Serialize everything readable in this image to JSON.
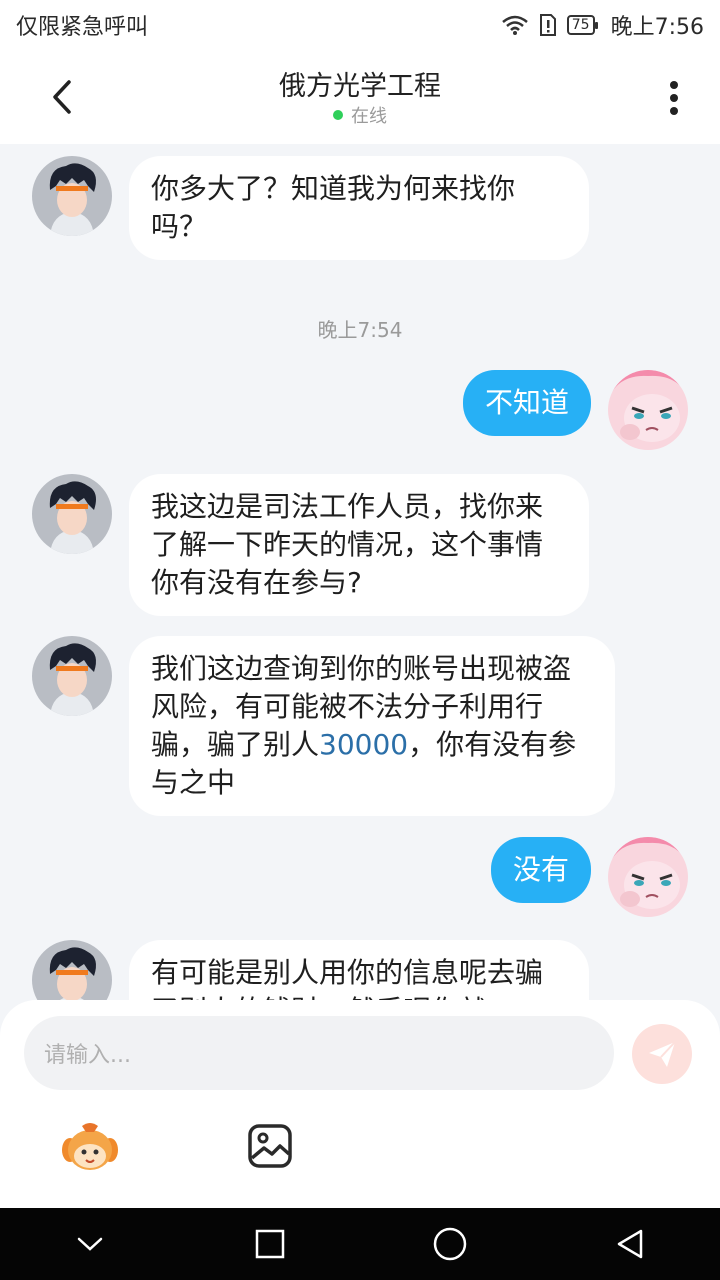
{
  "status_bar": {
    "left_text": "仅限紧急呼叫",
    "battery": "75",
    "time": "晚上7:56"
  },
  "header": {
    "title": "俄方光学工程",
    "status": "在线"
  },
  "messages": [
    {
      "side": "in",
      "text": "你多大了？知道我为何来找你吗？"
    },
    {
      "timestamp": "晚上7:54"
    },
    {
      "side": "out",
      "text": "不知道"
    },
    {
      "side": "in",
      "text": "我这边是司法工作人员，找你来了解一下昨天的情况，这个事情你有没有在参与?"
    },
    {
      "side": "in",
      "text_before": "我们这边查询到你的账号出现被盗风险，有可能被不法分子利用行骗，骗了别人",
      "amount": "30000",
      "text_after": "，你有没有参与之中"
    },
    {
      "side": "out",
      "text": "没有"
    },
    {
      "side": "in",
      "text": "有可能是别人用你的信息呢去骗了别人的钱财，然后呢你就"
    }
  ],
  "composer": {
    "placeholder": "请输入..."
  },
  "icons": {
    "back": "chevron-left-icon",
    "more": "more-vertical-icon",
    "send": "send-icon",
    "emoji": "emoji-mascot-icon",
    "image": "image-icon",
    "nav": [
      "nav-back-down-icon",
      "recents-square-icon",
      "home-circle-icon",
      "back-triangle-icon"
    ]
  },
  "colors": {
    "outgoing_bubble": "#27b0f5",
    "incoming_bubble": "#ffffff",
    "background": "#f3f5f8",
    "online_dot": "#2fcf5a",
    "highlight": "#2b6fa8"
  }
}
